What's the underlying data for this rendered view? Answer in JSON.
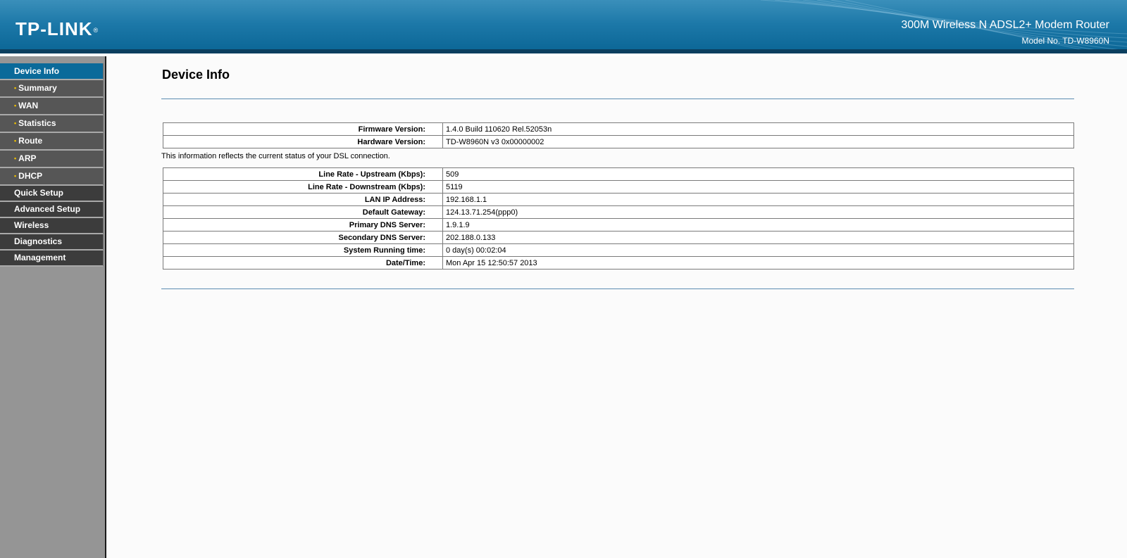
{
  "header": {
    "logo_text": "TP-LINK",
    "logo_mark": "®",
    "product_title": "300M Wireless N ADSL2+ Modem Router",
    "model_no": "Model No. TD-W8960N"
  },
  "sidebar": {
    "items": [
      {
        "label": "Device Info",
        "state": "active"
      },
      {
        "label": "Summary",
        "state": "sub"
      },
      {
        "label": "WAN",
        "state": "sub"
      },
      {
        "label": "Statistics",
        "state": "sub"
      },
      {
        "label": "Route",
        "state": "sub"
      },
      {
        "label": "ARP",
        "state": "sub"
      },
      {
        "label": "DHCP",
        "state": "sub"
      },
      {
        "label": "Quick Setup",
        "state": "main"
      },
      {
        "label": "Advanced Setup",
        "state": "main"
      },
      {
        "label": "Wireless",
        "state": "main"
      },
      {
        "label": "Diagnostics",
        "state": "main"
      },
      {
        "label": "Management",
        "state": "main"
      }
    ],
    "bullet_glyph": "•"
  },
  "main": {
    "title": "Device Info",
    "version_table": [
      {
        "label": "Firmware Version:",
        "value": "1.4.0 Build 110620 Rel.52053n"
      },
      {
        "label": "Hardware Version:",
        "value": "TD-W8960N v3 0x00000002"
      }
    ],
    "info_text": "This information reflects the current status of your DSL connection.",
    "status_table": [
      {
        "label": "Line Rate - Upstream (Kbps):",
        "value": "509"
      },
      {
        "label": "Line Rate - Downstream (Kbps):",
        "value": "5119"
      },
      {
        "label": "LAN IP Address:",
        "value": "192.168.1.1"
      },
      {
        "label": "Default Gateway:",
        "value": "124.13.71.254(ppp0)"
      },
      {
        "label": "Primary DNS Server:",
        "value": "1.9.1.9"
      },
      {
        "label": "Secondary DNS Server:",
        "value": "202.188.0.133"
      },
      {
        "label": "System Running time:",
        "value": "0 day(s) 00:02:04"
      },
      {
        "label": "Date/Time:",
        "value": "Mon Apr 15 12:50:57 2013"
      }
    ]
  },
  "colors": {
    "header_blue": "#1c78a8",
    "active_nav": "#0a6a9a",
    "sub_nav": "#565656",
    "main_nav": "#3c3c3c",
    "sidebar_bg": "#959595",
    "bullet": "#f2c200",
    "rule": "#5b8db1"
  }
}
